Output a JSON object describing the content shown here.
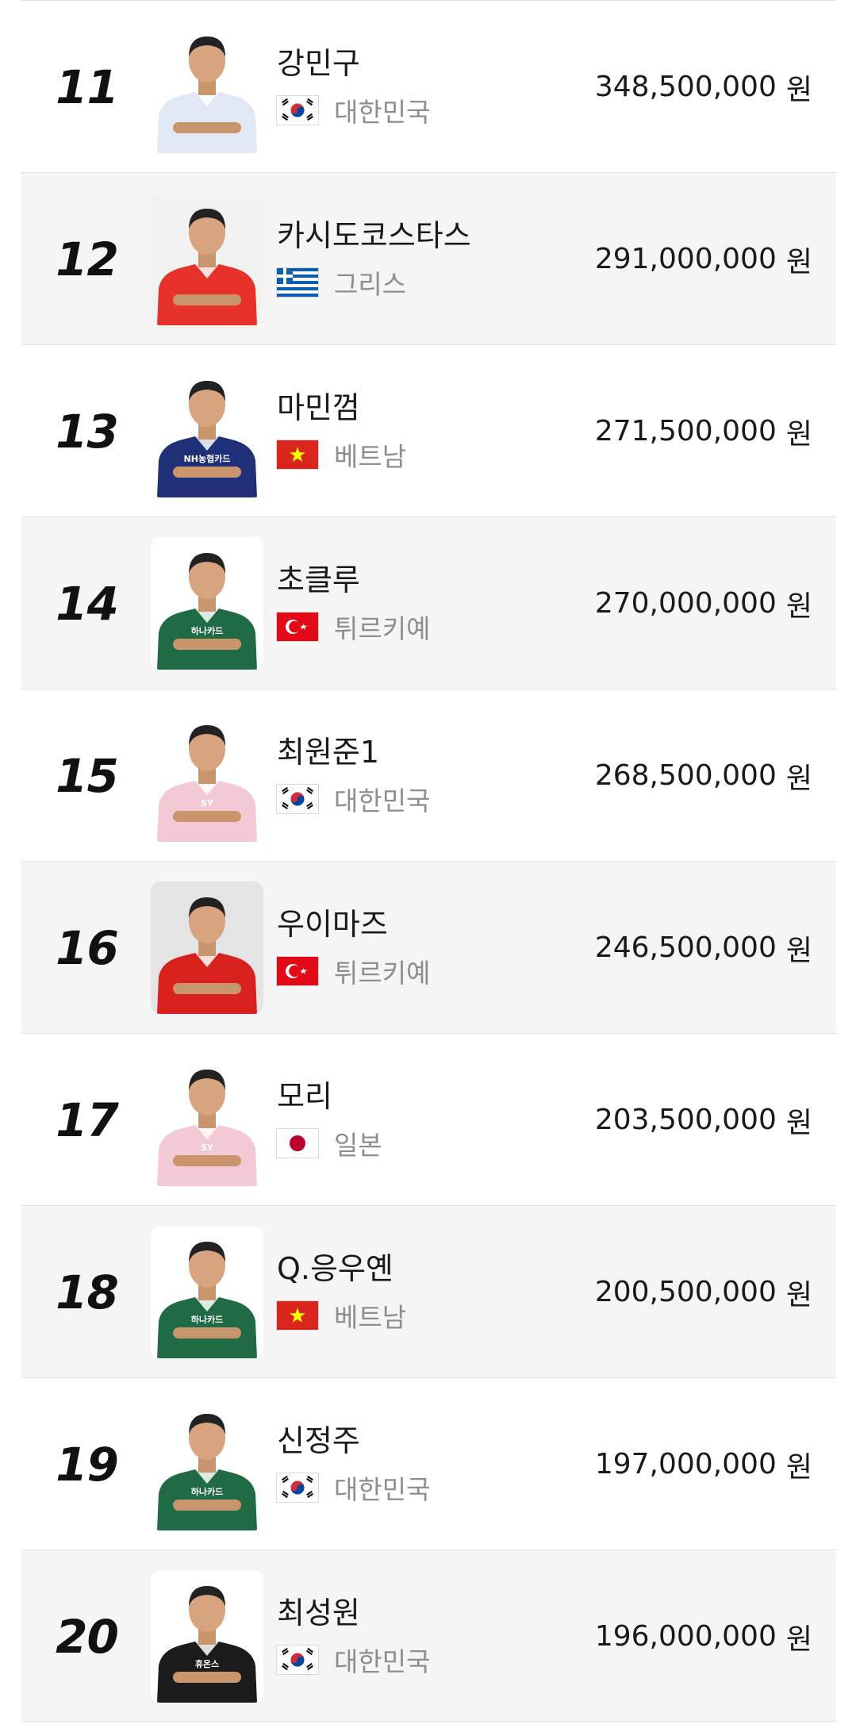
{
  "players": [
    {
      "rank": "11",
      "name": "강민구",
      "country": "대한민국",
      "flag": "kr",
      "prize": "348,500,000",
      "unit": "원",
      "shirt": "#dfe8f3",
      "photo_bg": "#ffffff",
      "shirt_text": ""
    },
    {
      "rank": "12",
      "name": "카시도코스타스",
      "country": "그리스",
      "flag": "gr",
      "prize": "291,000,000",
      "unit": "원",
      "shirt": "#e63228",
      "photo_bg": "#f2f2f2",
      "shirt_text": ""
    },
    {
      "rank": "13",
      "name": "마민껌",
      "country": "베트남",
      "flag": "vn",
      "prize": "271,500,000",
      "unit": "원",
      "shirt": "#1f2f78",
      "photo_bg": "#ffffff",
      "shirt_text": "NH농협카드"
    },
    {
      "rank": "14",
      "name": "초클루",
      "country": "튀르키예",
      "flag": "tr",
      "prize": "270,000,000",
      "unit": "원",
      "shirt": "#1f6b45",
      "photo_bg": "#ffffff",
      "shirt_text": "하나카드"
    },
    {
      "rank": "15",
      "name": "최원준1",
      "country": "대한민국",
      "flag": "kr",
      "prize": "268,500,000",
      "unit": "원",
      "shirt": "#f4c9d6",
      "photo_bg": "#ffffff",
      "shirt_text": "SY"
    },
    {
      "rank": "16",
      "name": "우이마즈",
      "country": "튀르키예",
      "flag": "tr",
      "prize": "246,500,000",
      "unit": "원",
      "shirt": "#d8211c",
      "photo_bg": "#e4e4e4",
      "shirt_text": ""
    },
    {
      "rank": "17",
      "name": "모리",
      "country": "일본",
      "flag": "jp",
      "prize": "203,500,000",
      "unit": "원",
      "shirt": "#f4c9d6",
      "photo_bg": "#ffffff",
      "shirt_text": "SY"
    },
    {
      "rank": "18",
      "name": "Q.응우옌",
      "country": "베트남",
      "flag": "vn",
      "prize": "200,500,000",
      "unit": "원",
      "shirt": "#1f6b45",
      "photo_bg": "#ffffff",
      "shirt_text": "하나카드"
    },
    {
      "rank": "19",
      "name": "신정주",
      "country": "대한민국",
      "flag": "kr",
      "prize": "197,000,000",
      "unit": "원",
      "shirt": "#1f6b45",
      "photo_bg": "#ffffff",
      "shirt_text": "하나카드"
    },
    {
      "rank": "20",
      "name": "최성원",
      "country": "대한민국",
      "flag": "kr",
      "prize": "196,000,000",
      "unit": "원",
      "shirt": "#1b1b1b",
      "photo_bg": "#ffffff",
      "shirt_text": "휴온스"
    }
  ]
}
